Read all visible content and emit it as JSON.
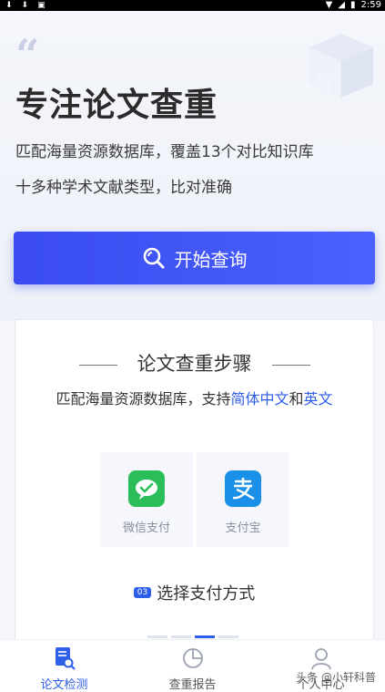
{
  "status_bar": {
    "time": "2:59"
  },
  "hero": {
    "title": "专注论文查重",
    "subtitle_line1": "匹配海量资源数据库，覆盖13个对比知识库",
    "subtitle_line2": "十多种学术文献类型，比对准确",
    "cta_label": "开始查询"
  },
  "steps": {
    "title": "论文查重步骤",
    "desc_prefix": "匹配海量资源数据库，支持",
    "desc_hl1": "简体中文",
    "desc_mid": "和",
    "desc_hl2": "英文",
    "payment_options": [
      {
        "label": "微信支付",
        "icon": "wechat-pay-icon",
        "color": "#2bbd5a"
      },
      {
        "label": "支付宝",
        "icon": "alipay-icon",
        "color": "#1a90e8"
      }
    ],
    "step_number": "03",
    "step_text": "选择支付方式",
    "carousel_active_index": 3
  },
  "tabbar": {
    "tabs": [
      {
        "label": "论文检测",
        "icon": "document-search-icon",
        "active": true
      },
      {
        "label": "查重报告",
        "icon": "pie-chart-icon",
        "active": false
      },
      {
        "label": "个人中心",
        "icon": "user-icon",
        "active": false
      }
    ]
  },
  "watermark": "头条 @小轩科普",
  "colors": {
    "primary": "#3a4cf0",
    "accent_text": "#2f5fe8"
  }
}
